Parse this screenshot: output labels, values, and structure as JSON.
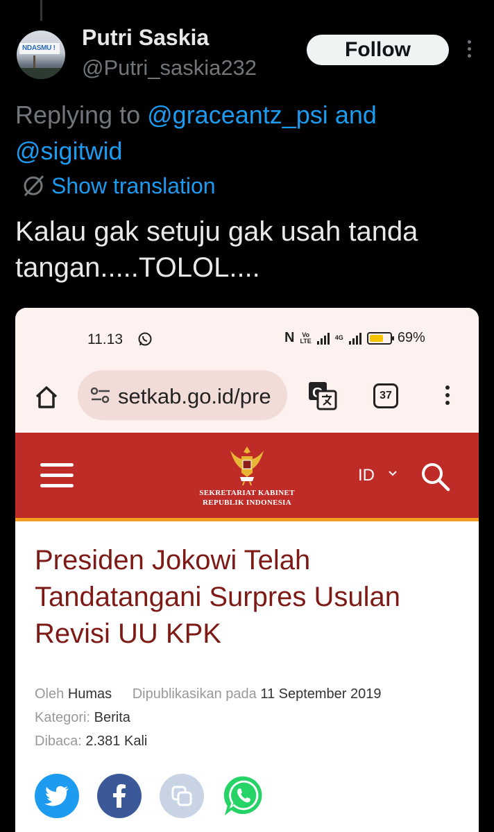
{
  "tweet": {
    "author_name": "Putri Saskia",
    "author_handle": "@Putri_saskia232",
    "avatar_sign_text": "NDASMU !",
    "follow_label": "Follow",
    "replying_prefix": "Replying to",
    "reply_user_1": "@graceantz_psi",
    "reply_and": "and",
    "reply_user_2": "@sigitwid",
    "translation_label": "Show translation",
    "text_line_1": "Kalau gak setuju gak usah tanda",
    "text_line_2": "tangan.....TOLOL...."
  },
  "screenshot": {
    "status_bar": {
      "time": "11.13",
      "network_label": "4G",
      "battery": "69%",
      "battery_level": 0.69
    },
    "browser": {
      "url": "setkab.go.id/pre",
      "tab_count": "37"
    },
    "site": {
      "name_line_1": "SEKRETARIAT KABINET",
      "name_line_2": "REPUBLIK INDONESIA",
      "language": "ID",
      "accent_color": "#bf2b27",
      "stripe_color": "#f0a020"
    },
    "article": {
      "headline_line_1": "Presiden Jokowi Telah",
      "headline_line_2": "Tandatangani Surpres Usulan",
      "headline_line_3": "Revisi UU KPK",
      "author_label": "Oleh",
      "author": "Humas",
      "published_label": "Dipublikasikan pada",
      "published_date": "11 September 2019",
      "category_label": "Kategori:",
      "category": "Berita",
      "reads_label": "Dibaca:",
      "reads": "2.381 Kali"
    },
    "share_icons": [
      "twitter-icon",
      "facebook-icon",
      "copy-link-icon",
      "whatsapp-icon"
    ]
  },
  "colors": {
    "background": "#000000",
    "link": "#1d9bf0",
    "muted": "#71767b",
    "headline": "#7d1a16"
  }
}
